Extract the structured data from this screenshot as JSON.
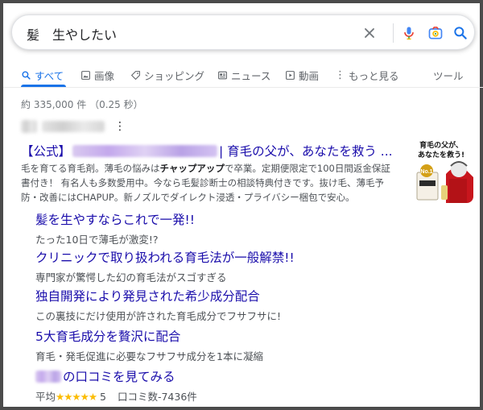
{
  "search": {
    "query": "髪　生やしたい"
  },
  "tabs": [
    {
      "label": "すべて",
      "icon": "search-icon",
      "active": true
    },
    {
      "label": "画像",
      "icon": "image-icon"
    },
    {
      "label": "ショッピング",
      "icon": "tag-icon"
    },
    {
      "label": "ニュース",
      "icon": "news-icon"
    },
    {
      "label": "動画",
      "icon": "video-icon"
    },
    {
      "label": "もっと見る",
      "icon": "more-vert-icon"
    }
  ],
  "tools_label": "ツール",
  "stats": "約 335,000 件 （0.25 秒）",
  "ad": {
    "title_prefix": "【公式】",
    "title_suffix": " | 育毛の父が、あなたを救う ...",
    "desc_1": "毛を育てる育毛剤。薄毛の悩みは",
    "desc_bold": "チャップアップ",
    "desc_2": "で卒業。定期便限定で100日間返金保証書付き！ 有名人も多数愛用中。今なら毛髪診断士の相談特典付きです。抜け毛、薄毛予防・改善にはCHAPUP。新ノズルでダイレクト浸透・プライバシー梱包で安心。",
    "thumb_text_1": "育毛の父が、",
    "thumb_text_2": "あなたを救う!",
    "thumb_badge": "No.1"
  },
  "sitelinks": [
    {
      "title": "髪を生やすならこれで一発!!",
      "desc": "たった10日で薄毛が激変!?"
    },
    {
      "title": "クリニックで取り扱われる育毛法が一般解禁!!",
      "desc": "専門家が驚愕した幻の育毛法がスゴすぎる"
    },
    {
      "title": "独自開発により発見された希少成分配合",
      "desc": "この裏技にだけ使用が許された育毛成分でフサフサに!"
    },
    {
      "title": "5大育毛成分を贅沢に配合",
      "desc": "育毛・発毛促進に必要なフサフサ成分を1本に凝縮"
    },
    {
      "title_suffix": "の口コミを見てみる",
      "rating_prefix": "平均",
      "stars": "★★★★★",
      "rating": "5",
      "reviews": "口コミ数-7436件"
    }
  ],
  "colors": {
    "link": "#1a0dab",
    "accent": "#1a73e8",
    "star": "#fbbc04"
  }
}
